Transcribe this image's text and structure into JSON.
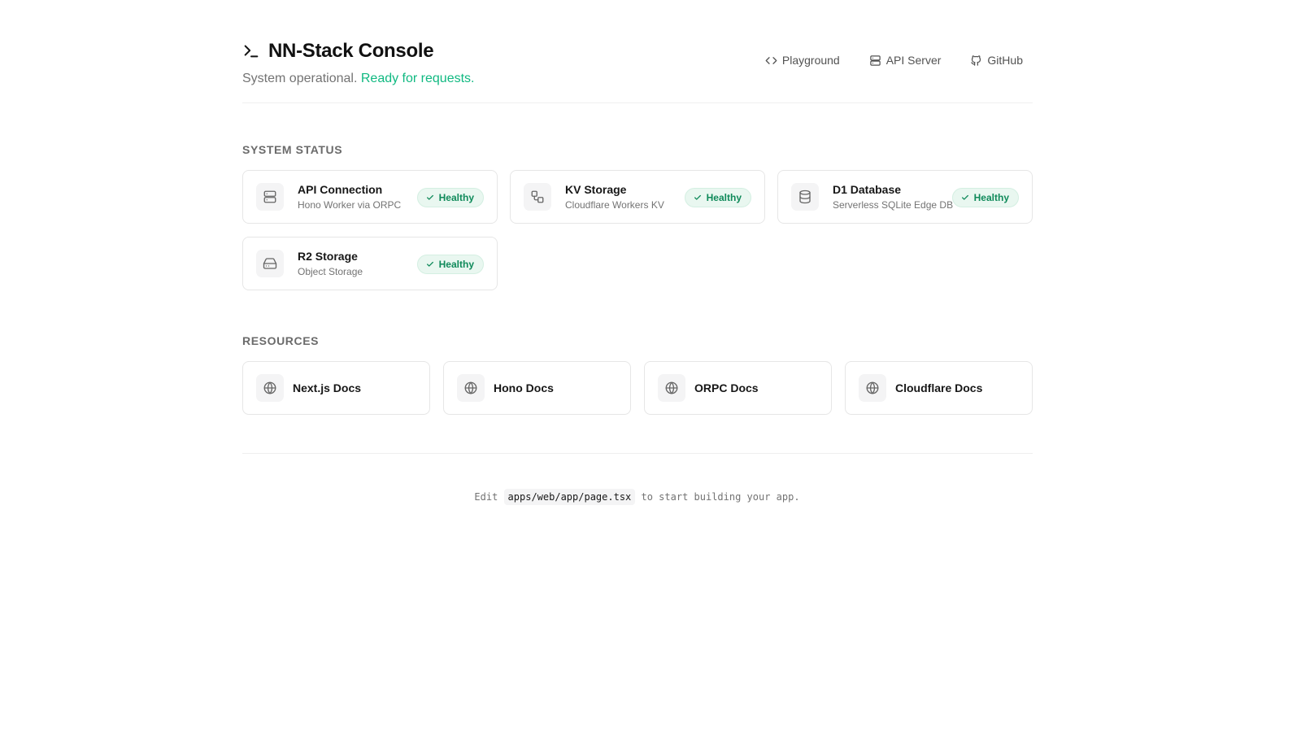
{
  "header": {
    "title": "NN-Stack Console",
    "title_icon": "terminal-icon",
    "subtitle_prefix": "System operational.",
    "subtitle_status": "Ready for requests.",
    "nav": [
      {
        "label": "Playground",
        "icon": "code-icon"
      },
      {
        "label": "API Server",
        "icon": "server-icon"
      },
      {
        "label": "GitHub",
        "icon": "github-icon"
      }
    ]
  },
  "system_status": {
    "label": "SYSTEM STATUS",
    "items": [
      {
        "title": "API Connection",
        "subtitle": "Hono Worker via ORPC",
        "status": "Healthy",
        "icon": "server-icon"
      },
      {
        "title": "KV Storage",
        "subtitle": "Cloudflare Workers KV",
        "status": "Healthy",
        "icon": "key-value-icon"
      },
      {
        "title": "D1 Database",
        "subtitle": "Serverless SQLite Edge DB",
        "status": "Healthy",
        "icon": "database-icon"
      },
      {
        "title": "R2 Storage",
        "subtitle": "Object Storage",
        "status": "Healthy",
        "icon": "hard-drive-icon"
      }
    ]
  },
  "resources": {
    "label": "RESOURCES",
    "items": [
      {
        "label": "Next.js Docs",
        "icon": "globe-icon"
      },
      {
        "label": "Hono Docs",
        "icon": "globe-icon"
      },
      {
        "label": "ORPC Docs",
        "icon": "globe-icon"
      },
      {
        "label": "Cloudflare Docs",
        "icon": "globe-icon"
      }
    ]
  },
  "footer": {
    "prefix": "Edit",
    "file": "apps/web/app/page.tsx",
    "suffix": "to start building your app."
  },
  "colors": {
    "accent": "#10b981",
    "badge_bg": "#e9f7f0",
    "badge_text": "#0f8a5a"
  }
}
